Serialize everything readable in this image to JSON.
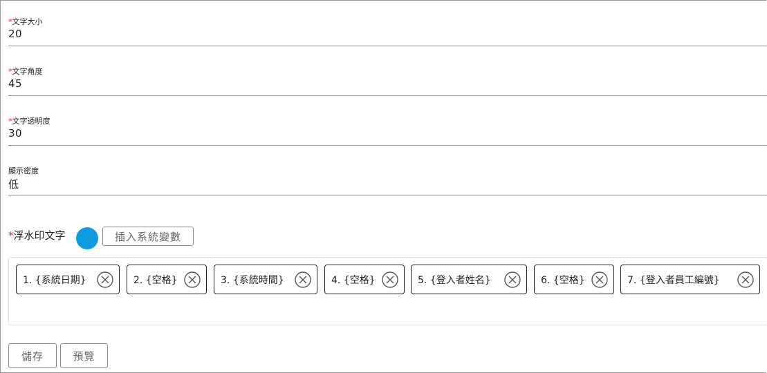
{
  "fields": [
    {
      "required": "*",
      "label": "文字大小",
      "value": "20"
    },
    {
      "required": "*",
      "label": "文字角度",
      "value": "45"
    },
    {
      "required": "*",
      "label": "文字透明度",
      "value": "30"
    },
    {
      "required": "",
      "label": "顯示密度",
      "value": "低"
    }
  ],
  "watermark": {
    "required": "*",
    "label": "浮水印文字",
    "insert_button_label": "插入系統變數",
    "tags": [
      {
        "label": "1. {系統日期}"
      },
      {
        "label": "2. {空格}"
      },
      {
        "label": "3. {系統時間}"
      },
      {
        "label": "4. {空格}"
      },
      {
        "label": "5. {登入者姓名}"
      },
      {
        "label": "6. {空格}"
      },
      {
        "label": "7. {登入者員工編號}"
      }
    ],
    "tag_remove_icon": "circle-x-icon",
    "info_icon": "info-dot-icon",
    "info_color": "#0f9be0"
  },
  "actions": {
    "save_label": "儲存",
    "preview_label": "預覽"
  },
  "colors": {
    "required_mark": "#d32f2f",
    "field_underline": "#9a9a9a"
  }
}
